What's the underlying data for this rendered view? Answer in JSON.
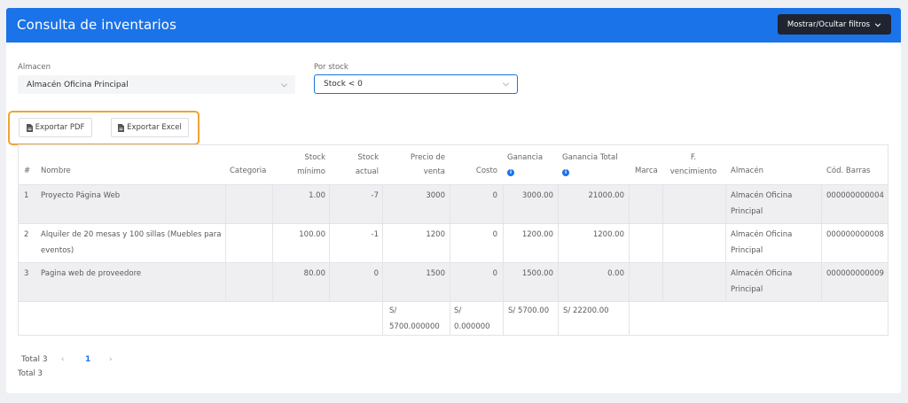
{
  "header": {
    "title": "Consulta de inventarios",
    "toggle_label": "Mostrar/Ocultar filtros"
  },
  "filters": {
    "almacen_label": "Almacen",
    "almacen_value": "Almacén Oficina Principal",
    "stock_label": "Por stock",
    "stock_value": "Stock < 0"
  },
  "exports": {
    "pdf_label": "Exportar PDF",
    "excel_label": "Exportar Excel"
  },
  "table": {
    "headers": {
      "num": "#",
      "nombre": "Nombre",
      "categoria": "Categoria",
      "stock_min_1": "Stock",
      "stock_min_2": "mínimo",
      "stock_act_1": "Stock",
      "stock_act_2": "actual",
      "precio_1": "Precio de",
      "precio_2": "venta",
      "costo": "Costo",
      "ganancia": "Ganancia",
      "ganancia_total": "Ganancia Total",
      "marca": "Marca",
      "venc_1": "F.",
      "venc_2": "vencimiento",
      "almacen": "Almacén",
      "cod": "Cód. Barras"
    },
    "rows": [
      {
        "num": "1",
        "nombre_1": "Proyecto Página Web",
        "nombre_2": "",
        "stock_min": "1.00",
        "stock_act": "-7",
        "precio": "3000",
        "costo": "0",
        "ganancia": "3000.00",
        "ganancia_total": "21000.00",
        "almacen_1": "Almacén Oficina",
        "almacen_2": "Principal",
        "cod": "000000000004"
      },
      {
        "num": "2",
        "nombre_1": "Alquiler de 20 mesas y 100 sillas (Muebles para",
        "nombre_2": "eventos)",
        "stock_min": "100.00",
        "stock_act": "-1",
        "precio": "1200",
        "costo": "0",
        "ganancia": "1200.00",
        "ganancia_total": "1200.00",
        "almacen_1": "Almacén Oficina",
        "almacen_2": "Principal",
        "cod": "000000000008"
      },
      {
        "num": "3",
        "nombre_1": "Pagina web de proveedore",
        "nombre_2": "",
        "stock_min": "80.00",
        "stock_act": "0",
        "precio": "1500",
        "costo": "0",
        "ganancia": "1500.00",
        "ganancia_total": "0.00",
        "almacen_1": "Almacén Oficina",
        "almacen_2": "Principal",
        "cod": "000000000009"
      }
    ],
    "totals": {
      "precio_1": "S/",
      "precio_2": "5700.000000",
      "costo_1": "S/",
      "costo_2": "0.000000",
      "ganancia": "S/ 5700.00",
      "ganancia_total": "S/ 22200.00"
    }
  },
  "pagination": {
    "total_label": "Total 3",
    "current_page": "1",
    "footer_total": "Total 3",
    "prev": "‹",
    "next": "›"
  }
}
